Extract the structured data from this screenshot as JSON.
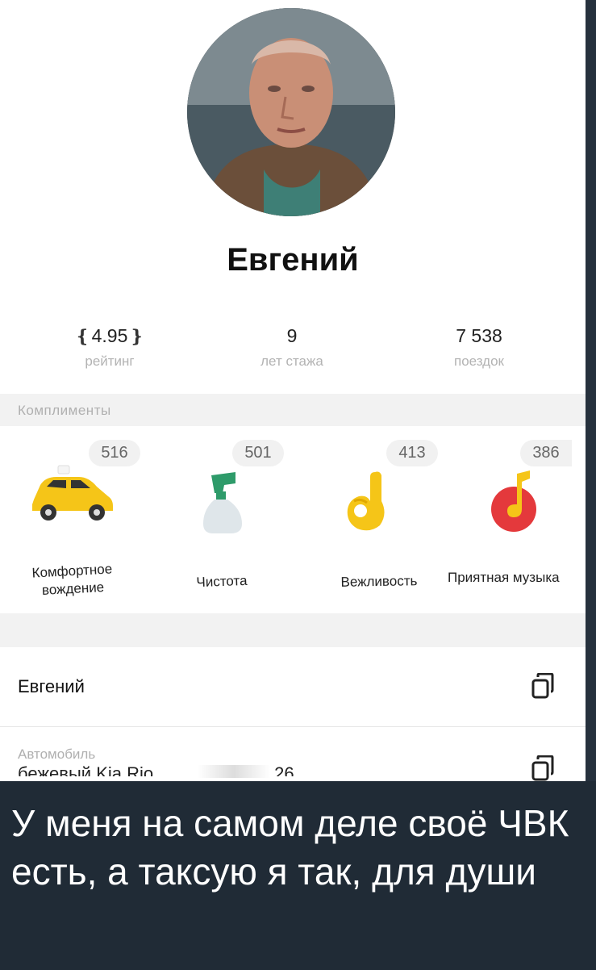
{
  "profile": {
    "name": "Евгений",
    "avatar_icon": "driver-photo"
  },
  "stats": {
    "rating": {
      "value": "4.95",
      "label": "рейтинг"
    },
    "experience": {
      "value": "9",
      "label": "лет стажа"
    },
    "trips": {
      "value": "7 538",
      "label": "поездок"
    }
  },
  "compliments": {
    "title": "Комплименты",
    "items": [
      {
        "count": "516",
        "label_line1": "Комфортное",
        "label_line2": "вождение",
        "icon": "taxi-car-icon"
      },
      {
        "count": "501",
        "label_line1": "Чистота",
        "label_line2": "",
        "icon": "spray-bottle-icon"
      },
      {
        "count": "413",
        "label_line1": "Вежливость",
        "label_line2": "",
        "icon": "ok-hand-icon"
      },
      {
        "count": "386",
        "label_line1": "Приятная музыка",
        "label_line2": "",
        "icon": "music-note-icon"
      }
    ]
  },
  "details": {
    "driver_name": "Евгений",
    "car_label": "Автомобиль",
    "car_value": "бежевый Kia Rio",
    "car_plate_suffix": "26"
  },
  "caption": "У меня на самом деле своё ЧВК есть, а таксую я так, для души",
  "colors": {
    "accent_yellow": "#f5c518",
    "music_red": "#e4393c",
    "caption_bg": "#202b36"
  }
}
